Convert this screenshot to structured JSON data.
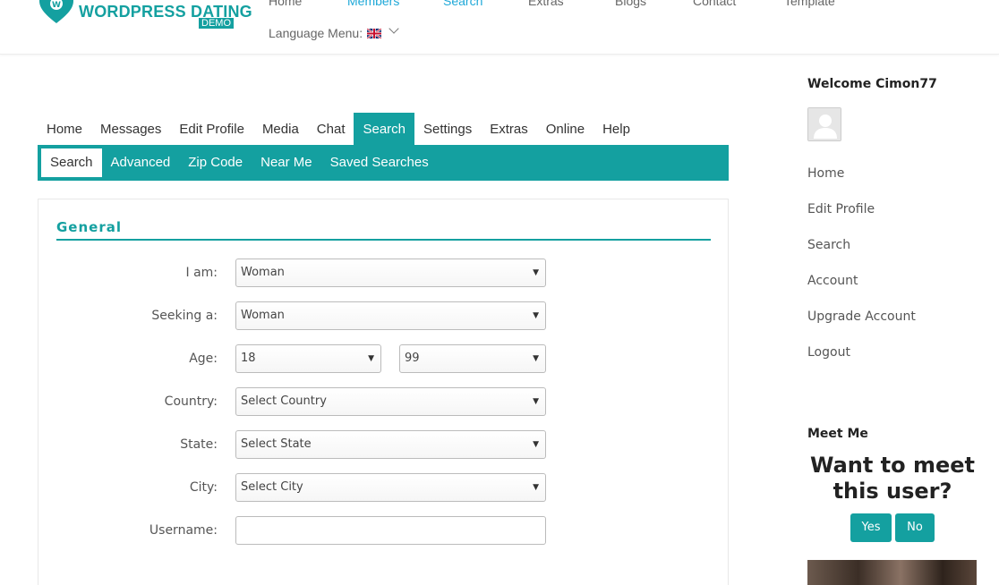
{
  "logo": {
    "text": "WORDPRESS DATING",
    "badge": "DEMO"
  },
  "top_nav": [
    {
      "label": "Home",
      "active": false
    },
    {
      "label": "Members",
      "active": true
    },
    {
      "label": "Search",
      "active": true
    },
    {
      "label": "Extras",
      "active": false
    },
    {
      "label": "Blogs",
      "active": false
    },
    {
      "label": "Contact",
      "active": false
    },
    {
      "label": "Template",
      "active": false
    }
  ],
  "language_menu": {
    "label": "Language Menu:",
    "flag_icon": "uk-flag-icon"
  },
  "member_tabs": [
    {
      "label": "Home",
      "active": false
    },
    {
      "label": "Messages",
      "active": false
    },
    {
      "label": "Edit Profile",
      "active": false
    },
    {
      "label": "Media",
      "active": false
    },
    {
      "label": "Chat",
      "active": false
    },
    {
      "label": "Search",
      "active": true
    },
    {
      "label": "Settings",
      "active": false
    },
    {
      "label": "Extras",
      "active": false
    },
    {
      "label": "Online",
      "active": false
    },
    {
      "label": "Help",
      "active": false
    }
  ],
  "sub_tabs": [
    {
      "label": "Search",
      "active": true
    },
    {
      "label": "Advanced",
      "active": false
    },
    {
      "label": "Zip Code",
      "active": false
    },
    {
      "label": "Near Me",
      "active": false
    },
    {
      "label": "Saved Searches",
      "active": false
    }
  ],
  "form": {
    "section_title": "General",
    "i_am": {
      "label": "I am:",
      "value": "Woman"
    },
    "seeking": {
      "label": "Seeking a:",
      "value": "Woman"
    },
    "age": {
      "label": "Age:",
      "min": "18",
      "max": "99"
    },
    "country": {
      "label": "Country:",
      "value": "Select Country"
    },
    "state": {
      "label": "State:",
      "value": "Select State"
    },
    "city": {
      "label": "City:",
      "value": "Select City"
    },
    "username": {
      "label": "Username:",
      "value": ""
    }
  },
  "sidebar": {
    "welcome": "Welcome Cimon77",
    "links": [
      "Home",
      "Edit Profile",
      "Search",
      "Account",
      "Upgrade Account",
      "Logout"
    ]
  },
  "meet_me": {
    "title": "Meet Me",
    "question": "Want to meet this user?",
    "yes_label": "Yes",
    "no_label": "No"
  },
  "colors": {
    "brand": "#14a0a0",
    "active_nav": "#1ea8d8"
  }
}
